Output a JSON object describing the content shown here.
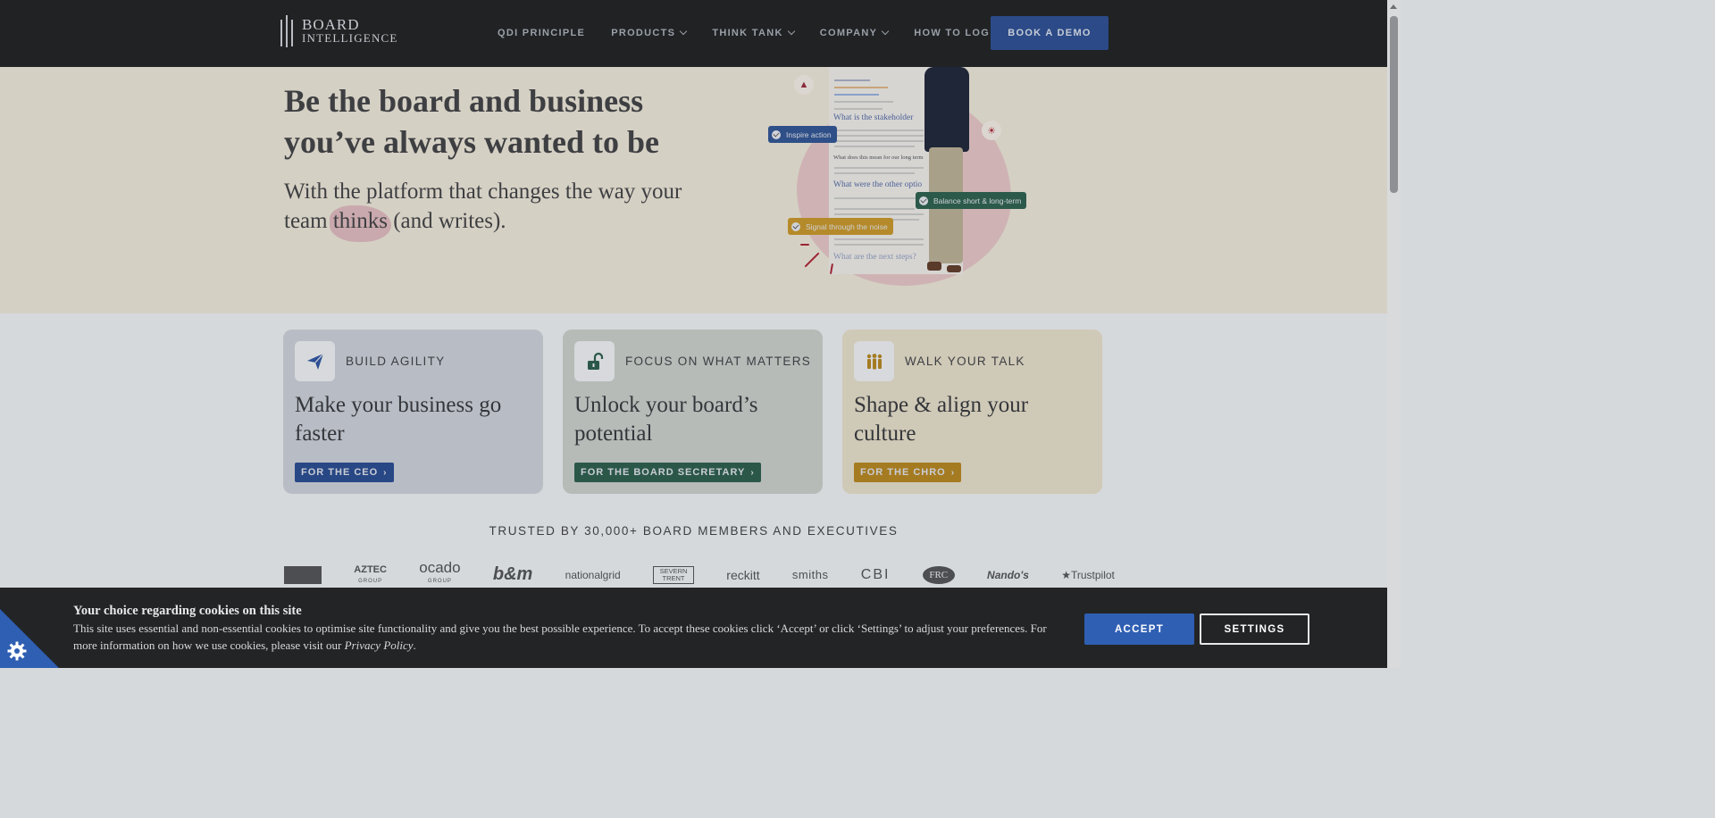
{
  "nav": {
    "logo_line1": "BOARD",
    "logo_line2": "INTELLIGENCE",
    "items": [
      {
        "label": "QDI PRINCIPLE",
        "dropdown": false
      },
      {
        "label": "PRODUCTS",
        "dropdown": true
      },
      {
        "label": "THINK TANK",
        "dropdown": true
      },
      {
        "label": "COMPANY",
        "dropdown": true
      },
      {
        "label": "HOW TO LOG IN",
        "dropdown": false
      }
    ],
    "cta": "BOOK A DEMO"
  },
  "hero": {
    "title": "Be the board and business you’ve always wanted to be",
    "sub_before": "With the platform that changes the way your team ",
    "sub_highlight": "thinks",
    "sub_after": " (and writes).",
    "illustration": {
      "doc_heading_1": "What is the stakeholder",
      "doc_heading_2": "What does this mean for our long term",
      "doc_heading_3": "What were the other optio",
      "doc_heading_4": "What are the next steps?",
      "tag_1": "Inspire action",
      "tag_2": "Balance short & long-term",
      "tag_3": "Signal through the noise"
    }
  },
  "cards": [
    {
      "icon": "paper-plane-icon",
      "kicker": "BUILD AGILITY",
      "title": "Make your business go faster",
      "button": "FOR THE CEO"
    },
    {
      "icon": "unlock-icon",
      "kicker": "FOCUS ON WHAT MATTERS",
      "title": "Unlock your board’s potential",
      "button": "FOR THE BOARD SECRETARY"
    },
    {
      "icon": "people-icon",
      "kicker": "WALK YOUR TALK",
      "title": "Shape & align your culture",
      "button": "FOR THE CHRO"
    }
  ],
  "trusted": {
    "heading": "TRUSTED BY 30,000+ BOARD MEMBERS AND EXECUTIVES",
    "logos": [
      "",
      "AZTEC",
      "ocado",
      "b&m",
      "nationalgrid",
      "SEVERN TRENT",
      "reckitt",
      "smiths",
      "CBI",
      "FRC",
      "Nando's",
      "Trustpilot"
    ],
    "sublabels": {
      "aztec": "GROUP",
      "ocado": "GROUP"
    }
  },
  "cookie": {
    "title": "Your choice regarding cookies on this site",
    "text_before": "This site uses essential and non-essential cookies to optimise site functionality and give you the best possible experience. To accept these cookies click ‘Accept’ or click ‘Settings’ to adjust your preferences. For more information on how we use cookies, please visit our ",
    "link": "Privacy Policy",
    "text_after": ".",
    "accept": "ACCEPT",
    "settings": "SETTINGS"
  },
  "colors": {
    "nav_bg": "#202224",
    "cta_blue": "#2b4a87",
    "ceo_blue": "#284785",
    "secretary_green": "#2b5749",
    "chro_amber": "#a57b22",
    "accept_blue": "#2f5fb3"
  }
}
